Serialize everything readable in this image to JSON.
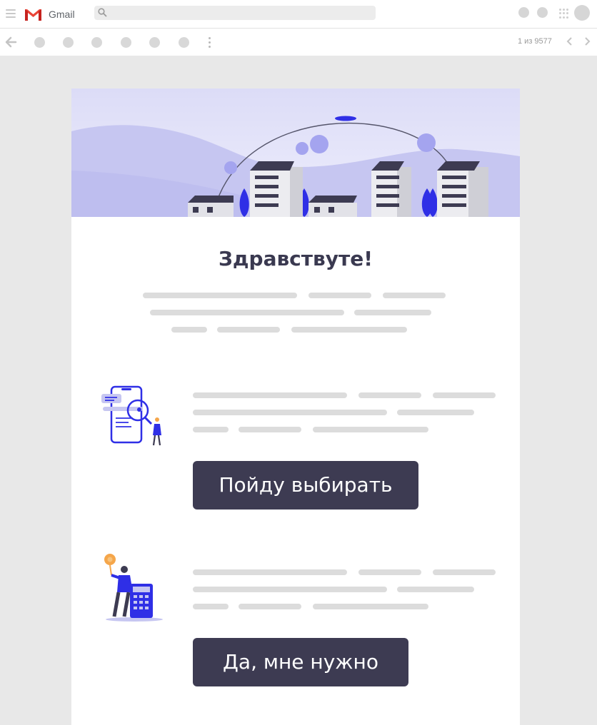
{
  "app": {
    "name": "Gmail",
    "brand_color": "#EA4335"
  },
  "header": {
    "search_placeholder": "",
    "icons": [
      "menu-icon",
      "gmail-logo",
      "search-icon",
      "apps-icon",
      "avatar"
    ]
  },
  "toolbar": {
    "pagination_text": "1 из 9577",
    "icons": [
      "back-arrow-icon",
      "more-vert-icon",
      "chevron-left-icon",
      "chevron-right-icon"
    ]
  },
  "email": {
    "greeting": "Здравствуте!",
    "section1": {
      "button_label": "Пойду выбирать"
    },
    "section2": {
      "button_label": "Да, мне нужно"
    },
    "colors": {
      "button_bg": "#3D3B52",
      "accent": "#2F2FE6",
      "hero_bg": "#E4E4FA"
    }
  }
}
